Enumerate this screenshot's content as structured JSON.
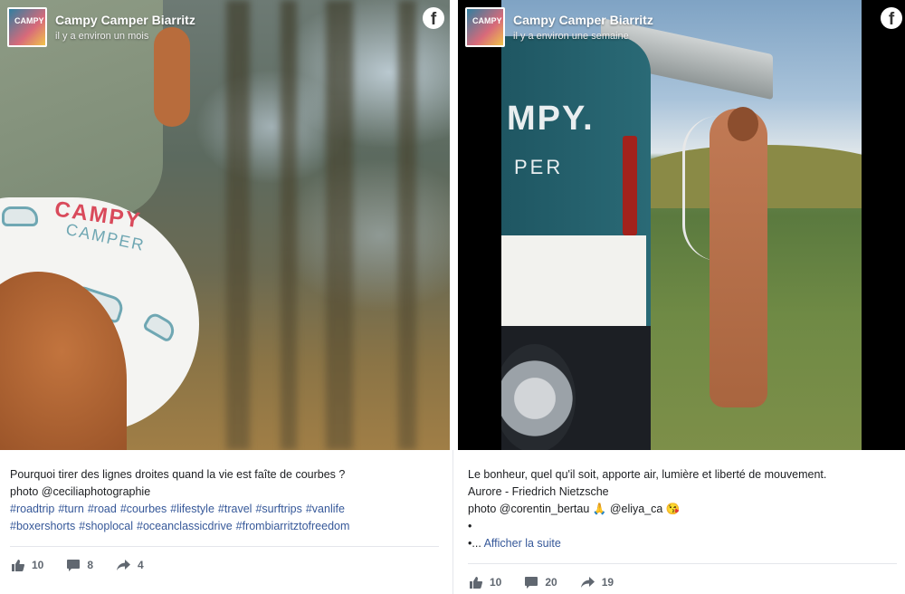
{
  "posts": [
    {
      "page_name": "Campy Camper Biarritz",
      "time": "il y a environ un mois",
      "avatar_text": "CAMPY",
      "caption_line1": "Pourquoi tirer des lignes droites quand la vie est faîte de courbes ?",
      "caption_line2": "photo @ceciliaphotographie",
      "hashtags_line1": [
        "#roadtrip",
        "#turn",
        "#road",
        "#courbes",
        "#lifestyle",
        "#travel",
        "#surftrips",
        "#vanlife"
      ],
      "hashtags_line2": [
        "#boxershorts",
        "#shoplocal",
        "#oceanclassicdrive",
        "#frombiarritztofreedom"
      ],
      "likes": "10",
      "comments": "8",
      "shares": "4",
      "print_brand": "CAMPY",
      "print_sub": "CAMPER"
    },
    {
      "page_name": "Campy Camper Biarritz",
      "time": "il y a environ une semaine",
      "avatar_text": "CAMPY",
      "caption_line1": "Le bonheur, quel qu'il soit, apporte air, lumière et liberté de mouvement.",
      "caption_line2": "Aurore - Friedrich Nietzsche",
      "caption_line3": "photo @corentin_bertau 🙏 @eliya_ca 😘",
      "caption_line4": "•",
      "caption_line5_prefix": "•... ",
      "see_more": "Afficher la suite",
      "likes": "10",
      "comments": "20",
      "shares": "19",
      "van_text": "MPY.",
      "van_sub": "PER"
    }
  ],
  "icons": {
    "facebook": "facebook-icon",
    "like": "thumbs-up-icon",
    "comment": "comment-icon",
    "share": "share-icon"
  },
  "colors": {
    "link": "#365899",
    "stat_text": "#606770",
    "divider": "#e4e6eb"
  }
}
